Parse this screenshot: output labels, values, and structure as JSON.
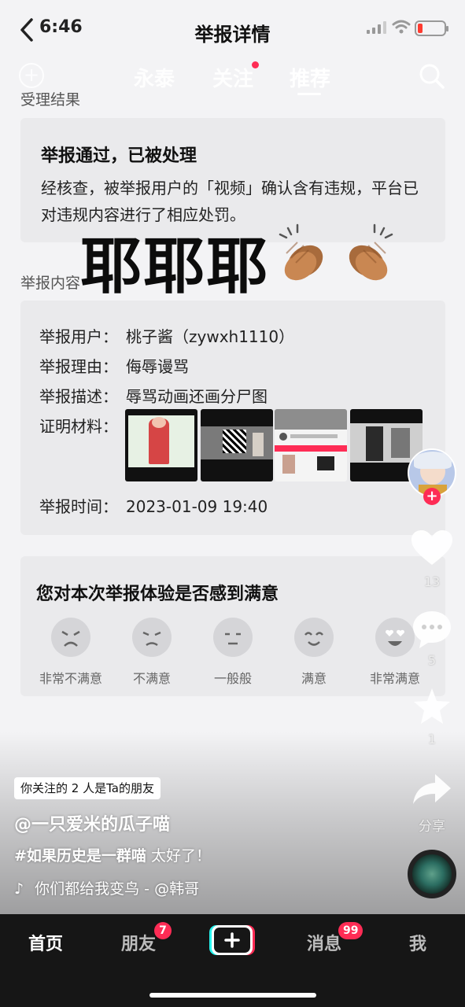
{
  "status_bar": {
    "time": "6:46"
  },
  "header": {
    "title": "举报详情"
  },
  "top_tabs": {
    "items": [
      "永泰",
      "关注",
      "推荐"
    ],
    "active": "推荐"
  },
  "result_section": {
    "label": "受理结果",
    "title": "举报通过，已被处理",
    "text": "经核查，被举报用户的「视频」确认含有违规，平台已对违规内容进行了相应处罚。"
  },
  "overlay": {
    "text": "耶耶耶",
    "emoji": "clapping-hands"
  },
  "content_section": {
    "label": "举报内容",
    "rows": [
      {
        "key": "举报用户：",
        "value": "桃子酱（zywxh1110）"
      },
      {
        "key": "举报理由：",
        "value": "侮辱谩骂"
      },
      {
        "key": "举报描述：",
        "value": "辱骂动画还画分尸图"
      },
      {
        "key": "证明材料：",
        "value": ""
      }
    ],
    "time_key": "举报时间：",
    "time_value": "2023-01-09 19:40"
  },
  "survey": {
    "title": "您对本次举报体验是否感到满意",
    "options": [
      "非常不满意",
      "不满意",
      "一般般",
      "满意",
      "非常满意"
    ]
  },
  "rail": {
    "likes": "13",
    "comments": "5",
    "favorites": "1",
    "share": "分享"
  },
  "video": {
    "follow_note": "你关注的 2 人是Ta的朋友",
    "author": "@一只爱米的瓜子喵",
    "hashtag": "#如果历史是一群喵",
    "caption_rest": " 太好了！",
    "music": "你们都给我变鸟 - @韩哥"
  },
  "nav": {
    "home": "首页",
    "friends": "朋友",
    "friends_badge": "7",
    "messages": "消息",
    "messages_badge": "99",
    "me": "我"
  },
  "colors": {
    "accent": "#fe2c55",
    "nav_bg": "#161616"
  }
}
